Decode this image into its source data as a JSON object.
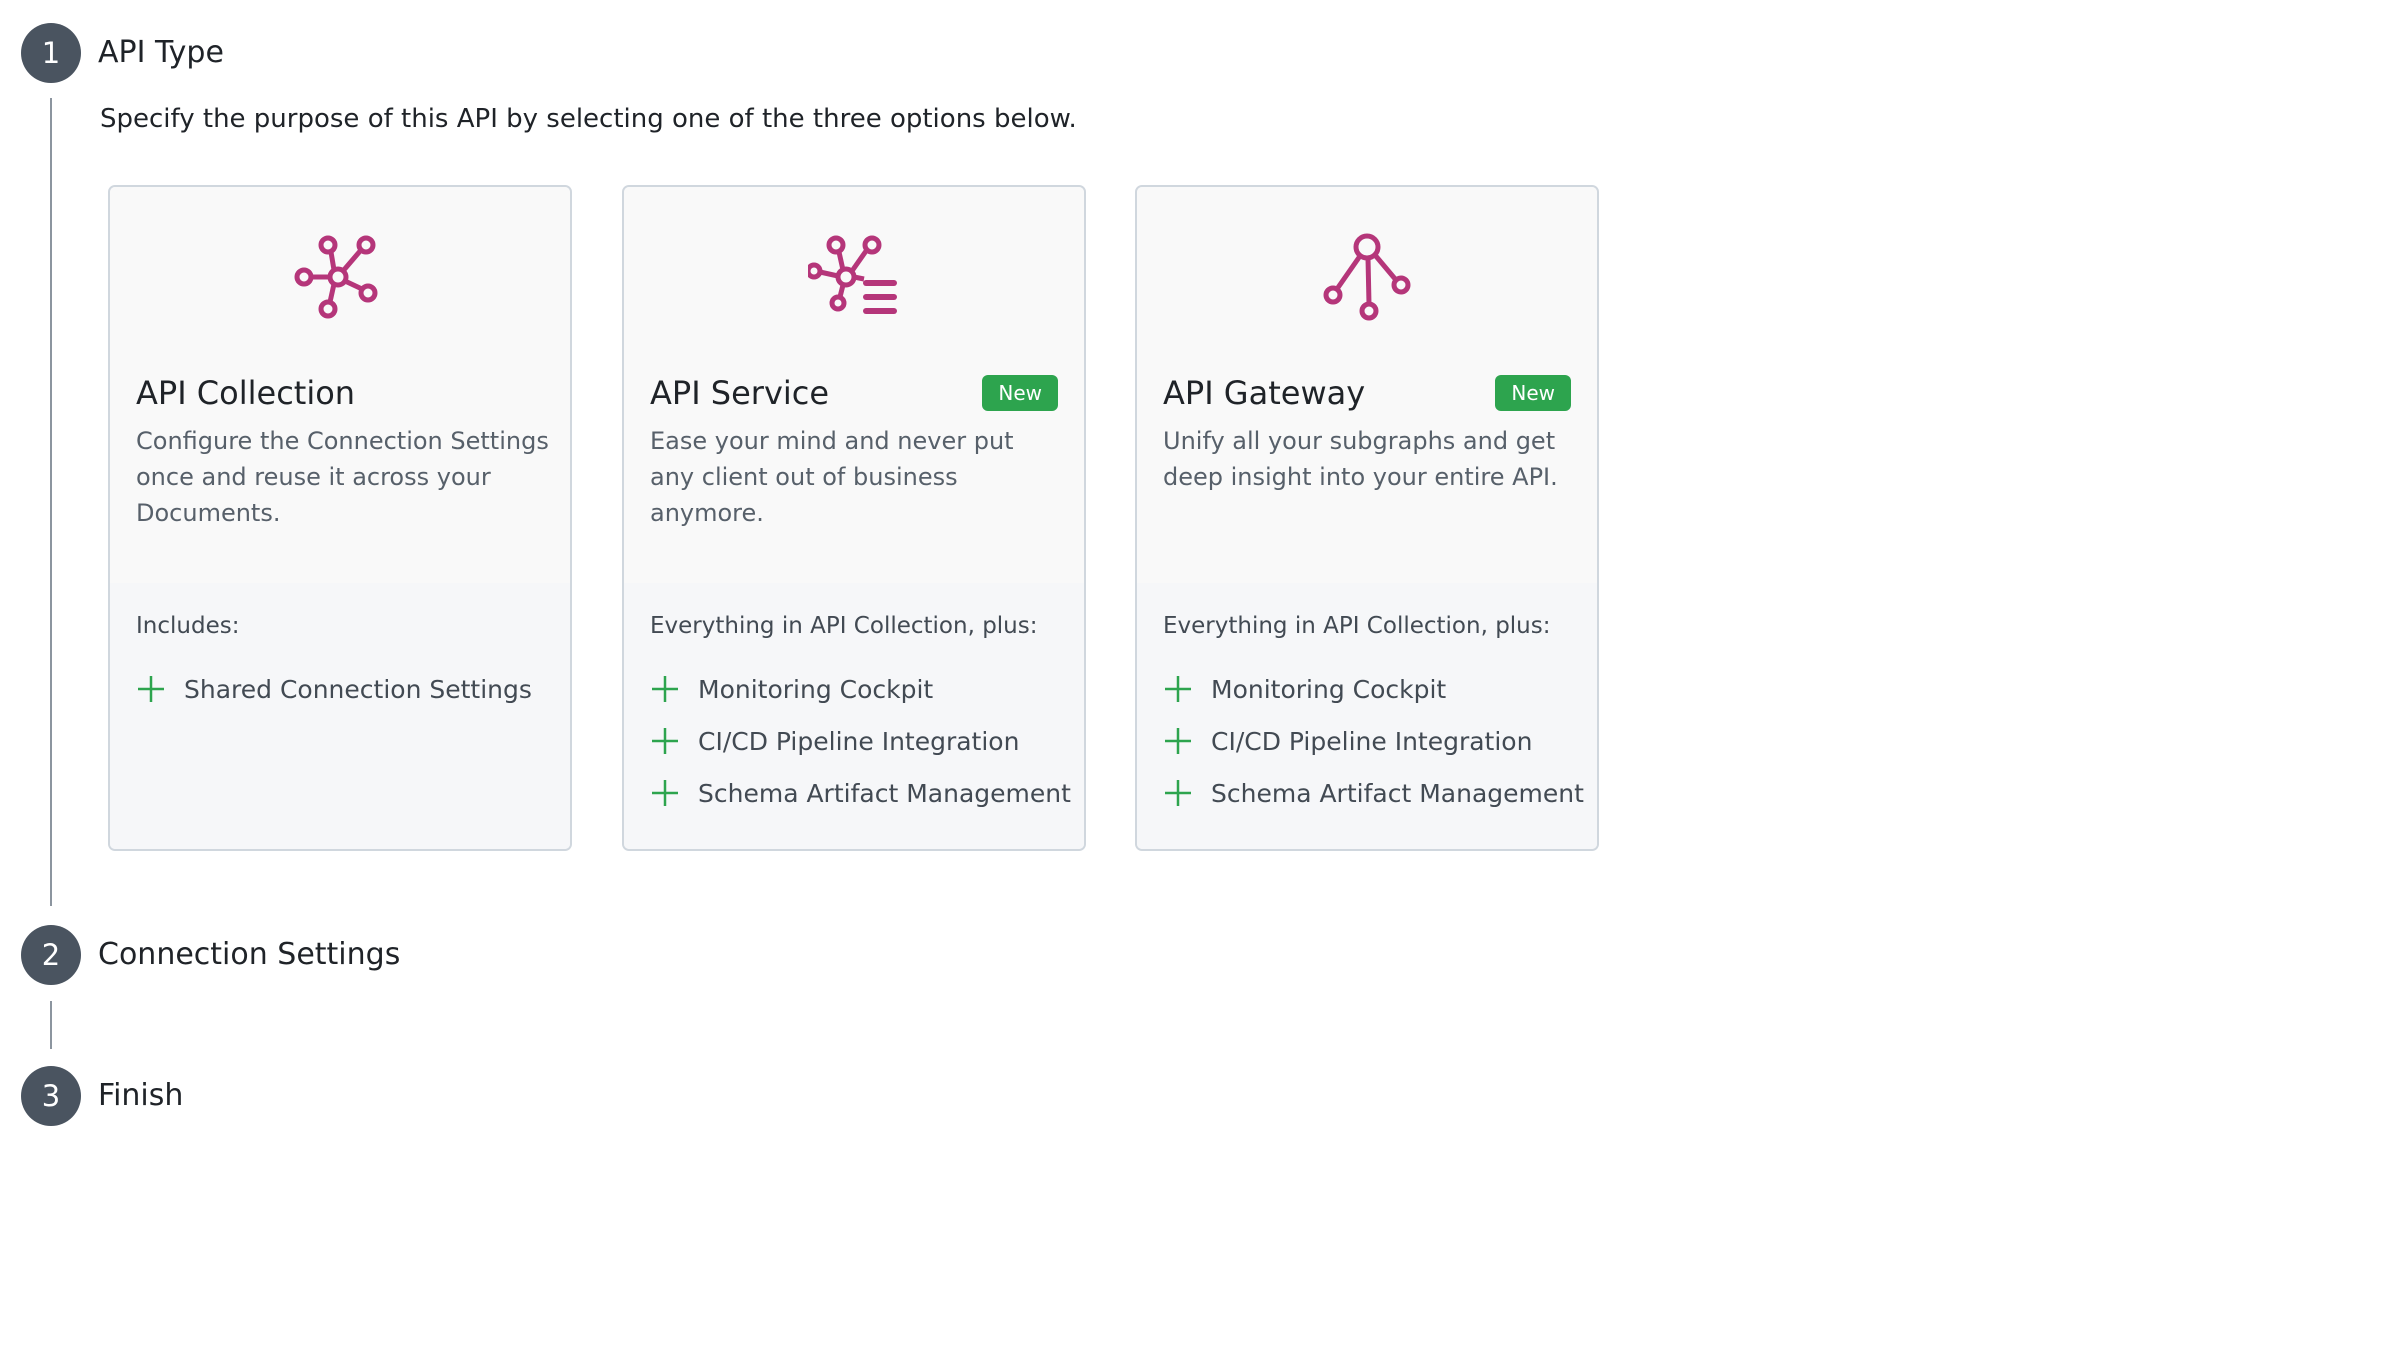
{
  "steps": [
    {
      "number": "1",
      "title": "API Type",
      "description": "Specify the purpose of this API by selecting one of the three options below."
    },
    {
      "number": "2",
      "title": "Connection Settings"
    },
    {
      "number": "3",
      "title": "Finish"
    }
  ],
  "colors": {
    "accent_icon": "#b5367a",
    "badge_green": "#2da44e",
    "plus_green": "#2da44e",
    "step_circle": "#4a5460"
  },
  "cards": [
    {
      "icon": "network-hub-icon",
      "title": "API Collection",
      "badge": "",
      "description": "Configure the Connection Settings once and reuse it across your Documents.",
      "includes_label": "Includes:",
      "features": [
        "Shared Connection Settings"
      ]
    },
    {
      "icon": "network-database-icon",
      "title": "API Service",
      "badge": "New",
      "description": "Ease your mind and never put any client out of business anymore.",
      "includes_label": "Everything in API Collection, plus:",
      "features": [
        "Monitoring Cockpit",
        "CI/CD Pipeline Integration",
        "Schema Artifact Management"
      ]
    },
    {
      "icon": "gateway-tree-icon",
      "title": "API Gateway",
      "badge": "New",
      "description": "Unify all your subgraphs and get deep insight into your entire API.",
      "includes_label": "Everything in API Collection, plus:",
      "features": [
        "Monitoring Cockpit",
        "CI/CD Pipeline Integration",
        "Schema Artifact Management"
      ]
    }
  ]
}
